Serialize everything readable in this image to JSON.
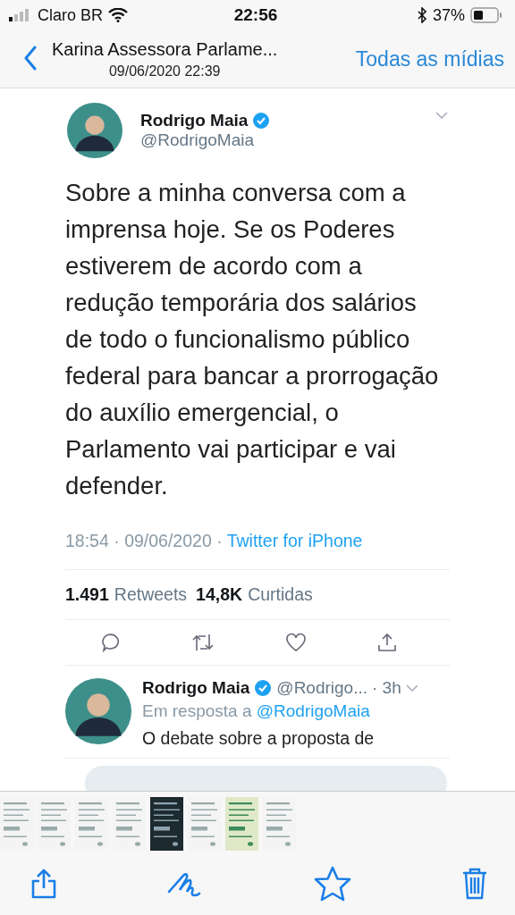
{
  "status_bar": {
    "carrier": "Claro BR",
    "time": "22:56",
    "battery": "37%"
  },
  "nav": {
    "title": "Karina Assessora Parlame...",
    "subtitle": "09/06/2020 22:39",
    "action": "Todas as mídias"
  },
  "tweet": {
    "name": "Rodrigo Maia",
    "handle": "@RodrigoMaia",
    "verified": true,
    "text": "Sobre a minha conversa com a imprensa hoje. Se os Poderes estiverem de acordo com a redução temporária dos salários de todo o funcionalismo público federal para bancar a prorrogação do auxílio emergencial, o Parlamento vai participar e vai defender.",
    "time": "18:54 · 09/06/2020 · ",
    "source": "Twitter for iPhone",
    "retweets": "1.491",
    "retweets_label": "Retweets",
    "likes": "14,8K",
    "likes_label": "Curtidas"
  },
  "reply": {
    "name": "Rodrigo Maia",
    "verified": true,
    "handle": "@Rodrigo...",
    "age": "· 3h",
    "in_reply_label": "Em resposta a ",
    "in_reply_to": "@RodrigoMaia",
    "text": "O debate sobre a proposta de"
  },
  "thumbnails": [
    {
      "kind": "doc"
    },
    {
      "kind": "doc"
    },
    {
      "kind": "doc"
    },
    {
      "kind": "doc"
    },
    {
      "kind": "dark"
    },
    {
      "kind": "doc"
    },
    {
      "kind": "green"
    },
    {
      "kind": "doc"
    }
  ]
}
